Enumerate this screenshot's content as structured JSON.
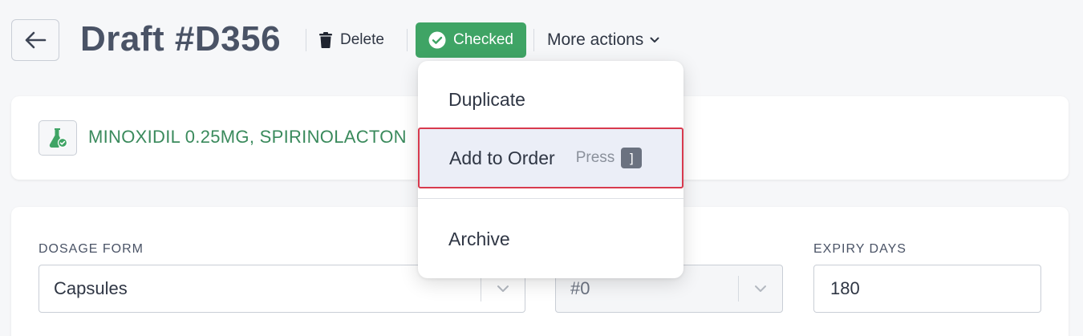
{
  "header": {
    "title": "Draft #D356",
    "delete_label": "Delete",
    "checked_label": "Checked",
    "more_actions_label": "More actions"
  },
  "formula": {
    "name": "MINOXIDIL 0.25MG, SPIRINOLACTON"
  },
  "menu": {
    "items": [
      {
        "label": "Duplicate"
      },
      {
        "label": "Add to Order",
        "shortcut_text": "Press",
        "shortcut_key": "]"
      },
      {
        "label": "Archive"
      }
    ]
  },
  "fields": {
    "dosage_form": {
      "label": "DOSAGE FORM",
      "value": "Capsules"
    },
    "capsule_size": {
      "value": "#0"
    },
    "expiry_days": {
      "label": "EXPIRY DAYS",
      "value": "180"
    }
  },
  "colors": {
    "checked_green": "#3fa465",
    "formula_green": "#3a8a5c",
    "highlight_border": "#d83a4e"
  }
}
